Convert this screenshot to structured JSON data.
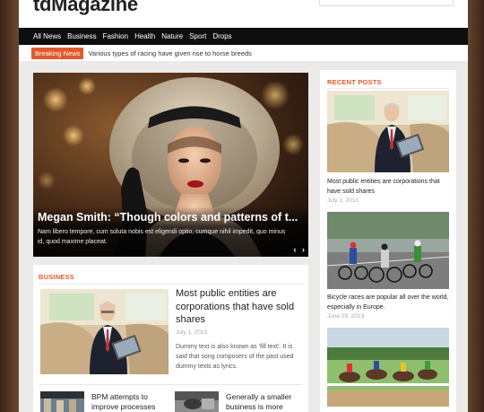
{
  "site": {
    "logo": "tdMagazine"
  },
  "nav": {
    "items": [
      "All News",
      "Business",
      "Fashion",
      "Health",
      "Nature",
      "Sport",
      "Drops"
    ]
  },
  "breaking": {
    "label": "Breaking News",
    "text": "Various types of racing have given rise to horse breeds"
  },
  "slider": {
    "title": "Megan Smith: “Though colors and patterns of t...",
    "excerpt": "Nam libero tempore, cum soluta nobis est eligendi optio, cumque nihil impedit, quo minus id, quod maxime placeat.",
    "prev": "‹",
    "next": "›"
  },
  "business": {
    "section_title": "BUSINESS",
    "feature": {
      "title": "Most public entities are corporations that have sold shares",
      "date": "July 1, 2013",
      "excerpt": "Dummy text is also known as ‘fill text’. It is said that song composers of the past used dummy texts as lyrics."
    },
    "small_posts": [
      {
        "title": "BPM attempts to improve processes"
      },
      {
        "title": "Generally a smaller business is more"
      }
    ]
  },
  "sidebar": {
    "section_title": "RECENT POSTS",
    "posts": [
      {
        "title": "Most public entities are corporations that have sold shares",
        "date": "July 1, 2013"
      },
      {
        "title": "Bicycle races are popular all over the world, especially in Europe.",
        "date": "June 29, 2013"
      },
      {
        "title": "",
        "date": ""
      }
    ]
  },
  "colors": {
    "accent": "#e05a2b",
    "nav_bg": "#0e0e0e"
  },
  "icons": {
    "slider_prev": "chevron-left-icon",
    "slider_next": "chevron-right-icon"
  }
}
